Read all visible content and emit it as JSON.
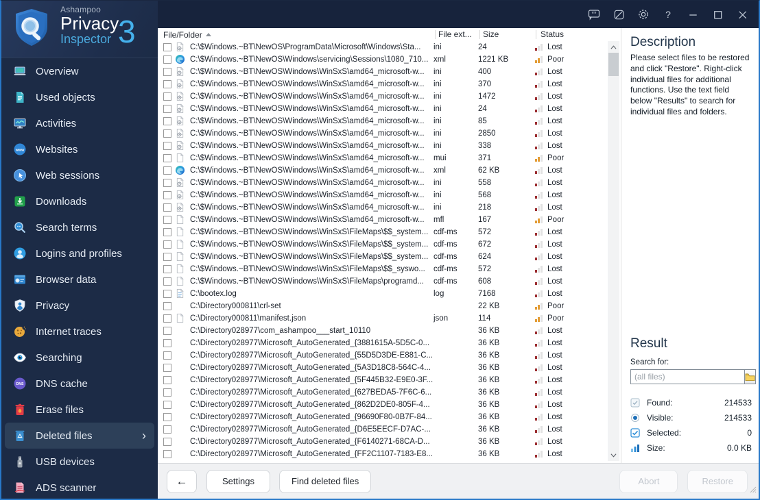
{
  "window": {
    "brand": "Ashampoo",
    "product": "Privacy",
    "product_sub": "Inspector",
    "version": "3"
  },
  "titlebar": {
    "buttons": [
      "feedback",
      "theme",
      "settings",
      "help",
      "minimize",
      "maximize",
      "close"
    ],
    "help_glyph": "?"
  },
  "colors": {
    "accent_blue": "#45b1ec",
    "status_lost": "#9b2d30",
    "status_poor": "#e39c35",
    "sidebar_bg": "#1c2b46",
    "titlebar_bg": "#17233c",
    "selected_bg": "#2d4059"
  },
  "sidebar": {
    "items": [
      {
        "label": "Overview",
        "icon": "overview",
        "selected": false
      },
      {
        "label": "Used objects",
        "icon": "used-objects",
        "selected": false
      },
      {
        "label": "Activities",
        "icon": "activities",
        "selected": false
      },
      {
        "label": "Websites",
        "icon": "websites",
        "selected": false
      },
      {
        "label": "Web sessions",
        "icon": "web-sessions",
        "selected": false
      },
      {
        "label": "Downloads",
        "icon": "downloads",
        "selected": false
      },
      {
        "label": "Search terms",
        "icon": "search-terms",
        "selected": false
      },
      {
        "label": "Logins and profiles",
        "icon": "logins",
        "selected": false
      },
      {
        "label": "Browser data",
        "icon": "browser-data",
        "selected": false
      },
      {
        "label": "Privacy",
        "icon": "privacy",
        "selected": false
      },
      {
        "label": "Internet traces",
        "icon": "internet-traces",
        "selected": false
      },
      {
        "label": "Searching",
        "icon": "searching",
        "selected": false
      },
      {
        "label": "DNS cache",
        "icon": "dns-cache",
        "selected": false
      },
      {
        "label": "Erase files",
        "icon": "erase-files",
        "selected": false
      },
      {
        "label": "Deleted files",
        "icon": "deleted-files",
        "selected": true,
        "chevron": "›"
      },
      {
        "label": "USB devices",
        "icon": "usb-devices",
        "selected": false
      },
      {
        "label": "ADS scanner",
        "icon": "ads-scanner",
        "selected": false
      }
    ]
  },
  "table": {
    "columns": [
      {
        "label": "File/Folder",
        "sort": "asc"
      },
      {
        "label": "File ext..."
      },
      {
        "label": "Size"
      },
      {
        "label": "Status"
      }
    ],
    "rows": [
      {
        "icon": "gear",
        "path": "C:\\$Windows.~BT\\NewOS\\ProgramData\\Microsoft\\Windows\\Sta...",
        "ext": "ini",
        "size": "24",
        "status": "Lost"
      },
      {
        "icon": "edge",
        "path": "C:\\$Windows.~BT\\NewOS\\Windows\\servicing\\Sessions\\1080_710...",
        "ext": "xml",
        "size": "1221 KB",
        "status": "Poor"
      },
      {
        "icon": "gear",
        "path": "C:\\$Windows.~BT\\NewOS\\Windows\\WinSxS\\amd64_microsoft-w...",
        "ext": "ini",
        "size": "400",
        "status": "Lost"
      },
      {
        "icon": "gear",
        "path": "C:\\$Windows.~BT\\NewOS\\Windows\\WinSxS\\amd64_microsoft-w...",
        "ext": "ini",
        "size": "370",
        "status": "Lost"
      },
      {
        "icon": "gear",
        "path": "C:\\$Windows.~BT\\NewOS\\Windows\\WinSxS\\amd64_microsoft-w...",
        "ext": "ini",
        "size": "1472",
        "status": "Lost"
      },
      {
        "icon": "gear",
        "path": "C:\\$Windows.~BT\\NewOS\\Windows\\WinSxS\\amd64_microsoft-w...",
        "ext": "ini",
        "size": "24",
        "status": "Lost"
      },
      {
        "icon": "gear",
        "path": "C:\\$Windows.~BT\\NewOS\\Windows\\WinSxS\\amd64_microsoft-w...",
        "ext": "ini",
        "size": "85",
        "status": "Lost"
      },
      {
        "icon": "gear",
        "path": "C:\\$Windows.~BT\\NewOS\\Windows\\WinSxS\\amd64_microsoft-w...",
        "ext": "ini",
        "size": "2850",
        "status": "Lost"
      },
      {
        "icon": "gear",
        "path": "C:\\$Windows.~BT\\NewOS\\Windows\\WinSxS\\amd64_microsoft-w...",
        "ext": "ini",
        "size": "338",
        "status": "Lost"
      },
      {
        "icon": "doc",
        "path": "C:\\$Windows.~BT\\NewOS\\Windows\\WinSxS\\amd64_microsoft-w...",
        "ext": "mui",
        "size": "371",
        "status": "Poor"
      },
      {
        "icon": "edge",
        "path": "C:\\$Windows.~BT\\NewOS\\Windows\\WinSxS\\amd64_microsoft-w...",
        "ext": "xml",
        "size": "62 KB",
        "status": "Lost"
      },
      {
        "icon": "gear",
        "path": "C:\\$Windows.~BT\\NewOS\\Windows\\WinSxS\\amd64_microsoft-w...",
        "ext": "ini",
        "size": "558",
        "status": "Lost"
      },
      {
        "icon": "gear",
        "path": "C:\\$Windows.~BT\\NewOS\\Windows\\WinSxS\\amd64_microsoft-w...",
        "ext": "ini",
        "size": "568",
        "status": "Lost"
      },
      {
        "icon": "gear",
        "path": "C:\\$Windows.~BT\\NewOS\\Windows\\WinSxS\\amd64_microsoft-w...",
        "ext": "ini",
        "size": "218",
        "status": "Lost"
      },
      {
        "icon": "doc",
        "path": "C:\\$Windows.~BT\\NewOS\\Windows\\WinSxS\\amd64_microsoft-w...",
        "ext": "mfl",
        "size": "167",
        "status": "Poor"
      },
      {
        "icon": "doc",
        "path": "C:\\$Windows.~BT\\NewOS\\Windows\\WinSxS\\FileMaps\\$$_system...",
        "ext": "cdf-ms",
        "size": "572",
        "status": "Lost"
      },
      {
        "icon": "doc",
        "path": "C:\\$Windows.~BT\\NewOS\\Windows\\WinSxS\\FileMaps\\$$_system...",
        "ext": "cdf-ms",
        "size": "672",
        "status": "Lost"
      },
      {
        "icon": "doc",
        "path": "C:\\$Windows.~BT\\NewOS\\Windows\\WinSxS\\FileMaps\\$$_system...",
        "ext": "cdf-ms",
        "size": "624",
        "status": "Lost"
      },
      {
        "icon": "doc",
        "path": "C:\\$Windows.~BT\\NewOS\\Windows\\WinSxS\\FileMaps\\$$_syswo...",
        "ext": "cdf-ms",
        "size": "572",
        "status": "Lost"
      },
      {
        "icon": "doc",
        "path": "C:\\$Windows.~BT\\NewOS\\Windows\\WinSxS\\FileMaps\\programd...",
        "ext": "cdf-ms",
        "size": "608",
        "status": "Lost"
      },
      {
        "icon": "log",
        "path": "C:\\bootex.log",
        "ext": "log",
        "size": "7168",
        "status": "Lost"
      },
      {
        "icon": "none",
        "path": "C:\\Directory000811\\crl-set",
        "ext": "",
        "size": "22 KB",
        "status": "Poor"
      },
      {
        "icon": "doc",
        "path": "C:\\Directory000811\\manifest.json",
        "ext": "json",
        "size": "114",
        "status": "Poor"
      },
      {
        "icon": "none",
        "path": "C:\\Directory028977\\com_ashampoo___start_10110",
        "ext": "",
        "size": "36 KB",
        "status": "Lost"
      },
      {
        "icon": "none",
        "path": "C:\\Directory028977\\Microsoft_AutoGenerated_{3881615A-5D5C-0...",
        "ext": "",
        "size": "36 KB",
        "status": "Lost"
      },
      {
        "icon": "none",
        "path": "C:\\Directory028977\\Microsoft_AutoGenerated_{55D5D3DE-E881-C...",
        "ext": "",
        "size": "36 KB",
        "status": "Lost"
      },
      {
        "icon": "none",
        "path": "C:\\Directory028977\\Microsoft_AutoGenerated_{5A3D18C8-564C-4...",
        "ext": "",
        "size": "36 KB",
        "status": "Lost"
      },
      {
        "icon": "none",
        "path": "C:\\Directory028977\\Microsoft_AutoGenerated_{5F445B32-E9E0-3F...",
        "ext": "",
        "size": "36 KB",
        "status": "Lost"
      },
      {
        "icon": "none",
        "path": "C:\\Directory028977\\Microsoft_AutoGenerated_{627BEDA5-7F6C-6...",
        "ext": "",
        "size": "36 KB",
        "status": "Lost"
      },
      {
        "icon": "none",
        "path": "C:\\Directory028977\\Microsoft_AutoGenerated_{862D2DE0-805F-4...",
        "ext": "",
        "size": "36 KB",
        "status": "Lost"
      },
      {
        "icon": "none",
        "path": "C:\\Directory028977\\Microsoft_AutoGenerated_{96690F80-0B7F-84...",
        "ext": "",
        "size": "36 KB",
        "status": "Lost"
      },
      {
        "icon": "none",
        "path": "C:\\Directory028977\\Microsoft_AutoGenerated_{D6E5EECF-D7AC-...",
        "ext": "",
        "size": "36 KB",
        "status": "Lost"
      },
      {
        "icon": "none",
        "path": "C:\\Directory028977\\Microsoft_AutoGenerated_{F6140271-68CA-D...",
        "ext": "",
        "size": "36 KB",
        "status": "Lost"
      },
      {
        "icon": "none",
        "path": "C:\\Directory028977\\Microsoft_AutoGenerated_{FF2C1107-7183-E8...",
        "ext": "",
        "size": "36 KB",
        "status": "Lost"
      }
    ]
  },
  "description": {
    "title": "Description",
    "body": "Please select files to be restored and click \"Restore\". Right-click individual files for additional functions. Use the text field below \"Results\" to search for individual files and folders."
  },
  "result": {
    "title": "Result",
    "search_label": "Search for:",
    "search_placeholder": "(all files)",
    "stats": [
      {
        "icon": "found",
        "label": "Found:",
        "value": "214533"
      },
      {
        "icon": "visible",
        "label": "Visible:",
        "value": "214533"
      },
      {
        "icon": "selected",
        "label": "Selected:",
        "value": "0"
      },
      {
        "icon": "size",
        "label": "Size:",
        "value": "0.0 KB"
      }
    ]
  },
  "footer": {
    "back_label": "←",
    "settings_label": "Settings",
    "find_label": "Find deleted files",
    "abort_label": "Abort",
    "restore_label": "Restore"
  }
}
